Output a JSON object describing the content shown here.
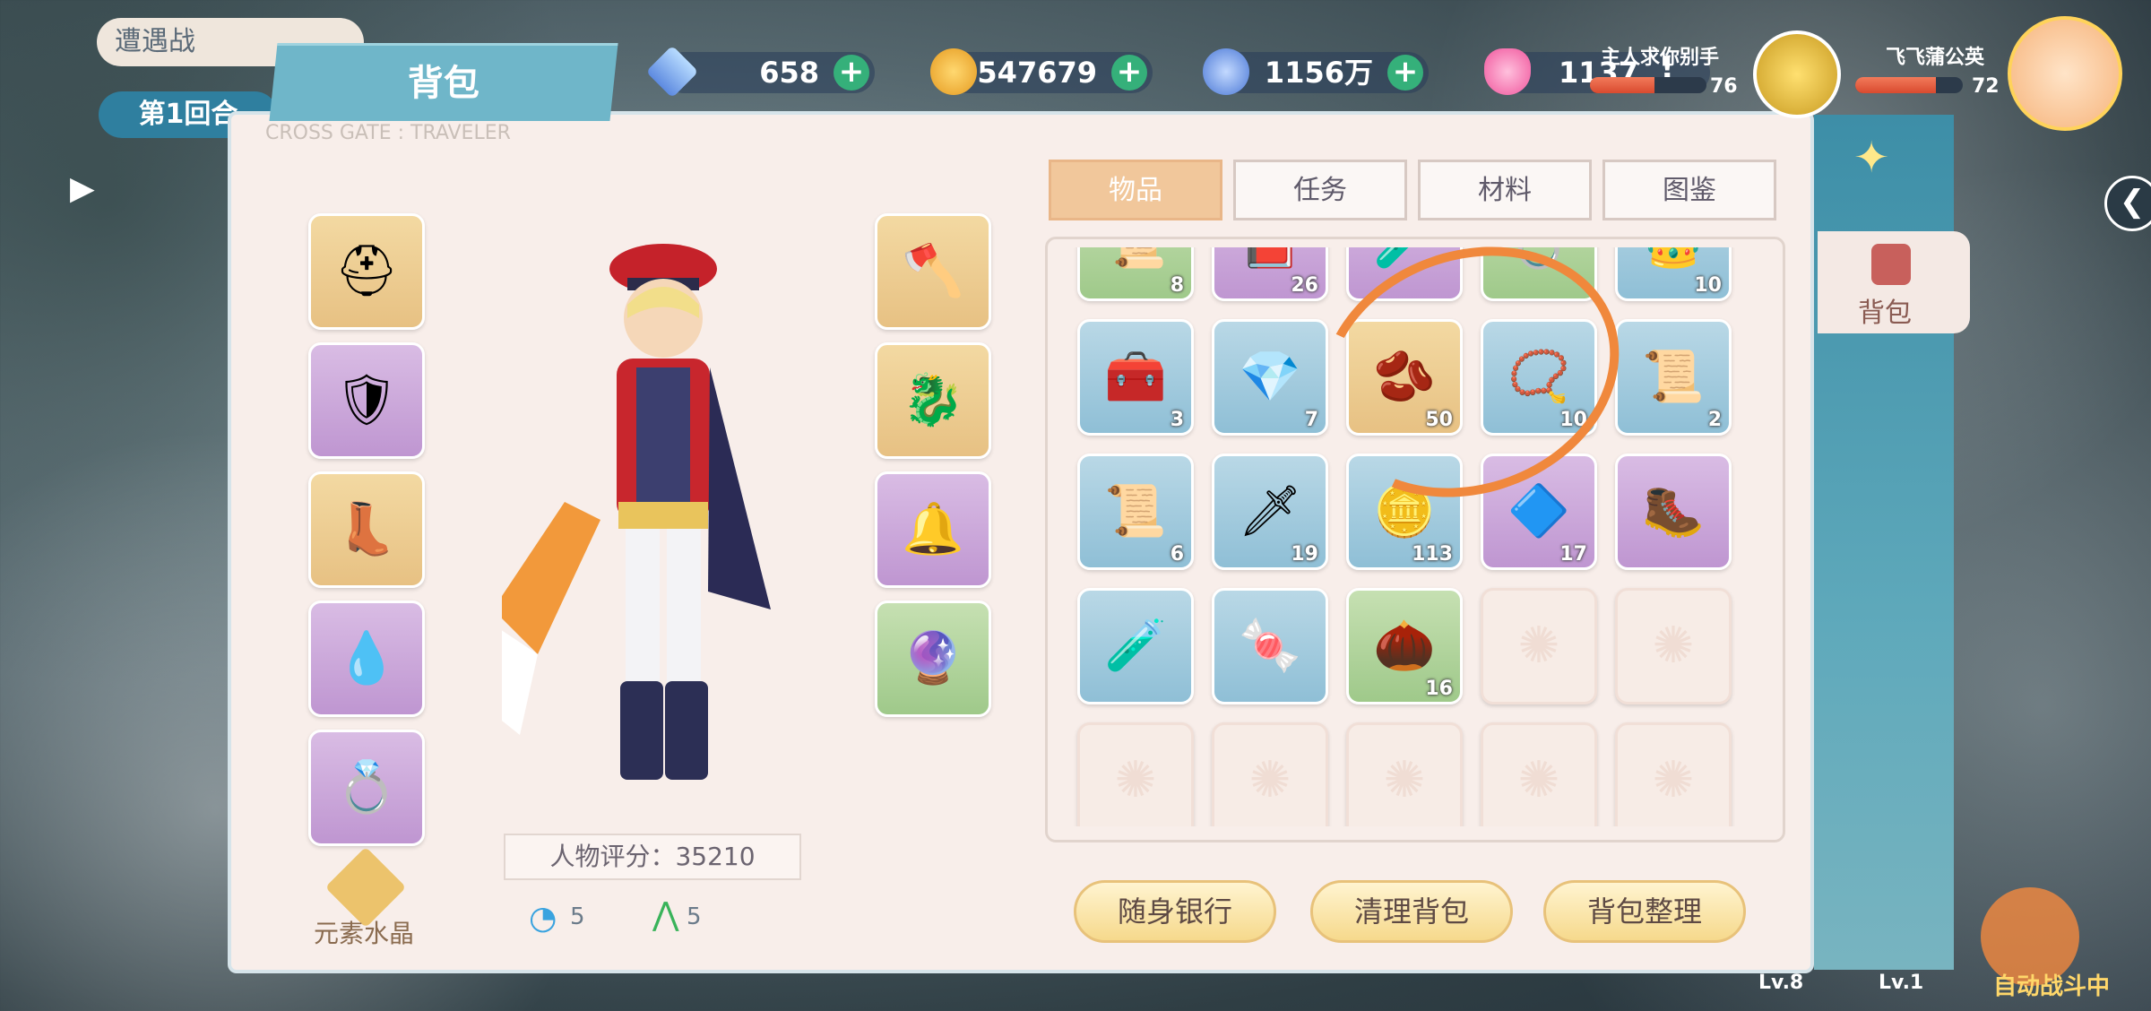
{
  "top": {
    "battle_label": "遭遇战",
    "round_label": "第1回合",
    "bag_title": "背包",
    "panel_subtitle": "CROSS GATE : TRAVELER"
  },
  "currency": [
    {
      "icon": "crystal-cube-icon",
      "value": "658",
      "color": "#7fb8ff"
    },
    {
      "icon": "gold-coin-icon",
      "value": "547679",
      "color": "#f1b53c"
    },
    {
      "icon": "blue-token-icon",
      "value": "1156万",
      "color": "#5b8ee0"
    },
    {
      "icon": "heart-gem-icon",
      "value": "1137",
      "color": "#ff70b0"
    }
  ],
  "players": {
    "ally": {
      "name": "主人求你别手",
      "level": "76",
      "hp_fraction": 0.55
    },
    "self": {
      "name": "飞飞蒲公英",
      "level": "72",
      "hp_fraction": 0.75
    }
  },
  "equipment": {
    "left": [
      {
        "icon": "helmet-icon",
        "color": "gold"
      },
      {
        "icon": "armor-icon",
        "color": "purple"
      },
      {
        "icon": "boots-icon",
        "color": "gold"
      },
      {
        "icon": "earrings-icon",
        "color": "purple"
      },
      {
        "icon": "ring-icon",
        "color": "purple"
      }
    ],
    "right": [
      {
        "icon": "axe-icon",
        "color": "gold"
      },
      {
        "icon": "dragon-pet-icon",
        "color": "gold"
      },
      {
        "icon": "bell-ribbon-icon",
        "color": "purple"
      },
      {
        "icon": "orb-icon",
        "color": "green"
      }
    ]
  },
  "character": {
    "score_label": "人物评分：35210",
    "crystal_label": "元素水晶",
    "stat1": "5",
    "stat2": "5"
  },
  "tabs": [
    {
      "label": "物品",
      "active": true
    },
    {
      "label": "任务",
      "active": false
    },
    {
      "label": "材料",
      "active": false
    },
    {
      "label": "图鉴",
      "active": false
    }
  ],
  "inventory_rows": [
    [
      {
        "icon": "scroll-icon",
        "count": "8",
        "color": "green"
      },
      {
        "icon": "book-icon",
        "count": "26",
        "color": "purple"
      },
      {
        "icon": "potion-icon",
        "count": "",
        "color": "purple"
      },
      {
        "icon": "ring-item-icon",
        "count": "",
        "color": "green"
      },
      {
        "icon": "crown-icon",
        "count": "10",
        "color": "blue"
      }
    ],
    [
      {
        "icon": "treasure-chest-icon",
        "count": "3",
        "color": "blue"
      },
      {
        "icon": "blue-crystal-icon",
        "count": "7",
        "color": "blue"
      },
      {
        "icon": "seeds-icon",
        "count": "50",
        "color": "gold"
      },
      {
        "icon": "necklace-scroll-icon",
        "count": "10",
        "color": "blue"
      },
      {
        "icon": "boots-scroll-icon",
        "count": "2",
        "color": "blue"
      }
    ],
    [
      {
        "icon": "boots-scroll-icon",
        "count": "6",
        "color": "blue"
      },
      {
        "icon": "sword-scroll-icon",
        "count": "19",
        "color": "blue"
      },
      {
        "icon": "silver-ingot-icon",
        "count": "113",
        "color": "blue"
      },
      {
        "icon": "rune-stone-icon",
        "count": "17",
        "color": "purple"
      },
      {
        "icon": "leather-boots-icon",
        "count": "",
        "color": "purple"
      }
    ],
    [
      {
        "icon": "potion-bottle-icon",
        "count": "",
        "color": "blue"
      },
      {
        "icon": "pumpkin-candy-icon",
        "count": "",
        "color": "blue"
      },
      {
        "icon": "walnut-icon",
        "count": "16",
        "color": "green"
      },
      {
        "icon": "empty-slot",
        "count": "",
        "color": "empty"
      },
      {
        "icon": "empty-slot",
        "count": "",
        "color": "empty"
      }
    ],
    [
      {
        "icon": "empty-slot",
        "count": "",
        "color": "empty"
      },
      {
        "icon": "empty-slot",
        "count": "",
        "color": "empty"
      },
      {
        "icon": "empty-slot",
        "count": "",
        "color": "empty"
      },
      {
        "icon": "empty-slot",
        "count": "",
        "color": "empty"
      },
      {
        "icon": "empty-slot",
        "count": "",
        "color": "empty"
      }
    ]
  ],
  "buttons": {
    "bank": "随身银行",
    "clean": "清理背包",
    "sort": "背包整理"
  },
  "side_tab": {
    "label": "背包"
  },
  "bottom": {
    "lv_left": "Lv.8",
    "lv_right": "Lv.1",
    "auto_battle": "自动战斗中"
  }
}
